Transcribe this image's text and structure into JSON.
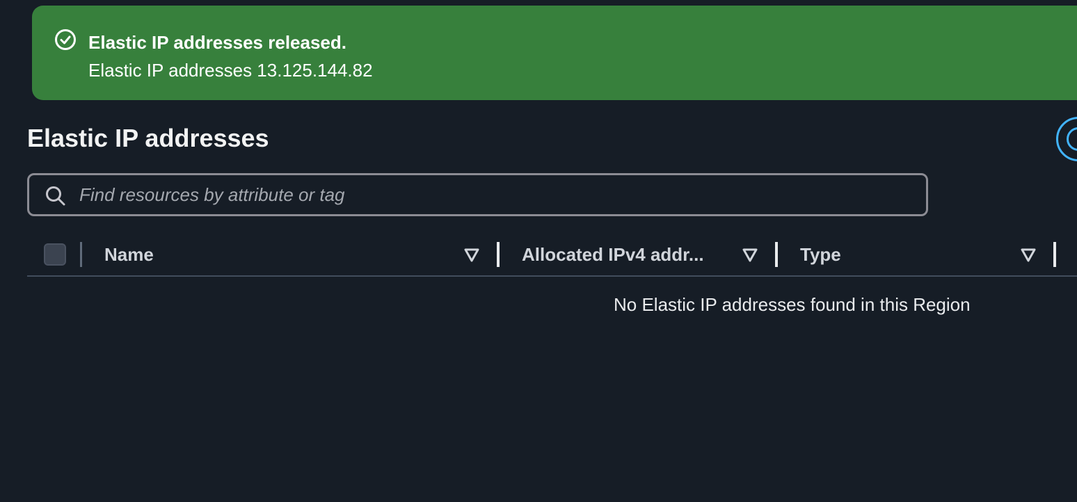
{
  "flash": {
    "type": "success",
    "title": "Elastic IP addresses released.",
    "message": "Elastic IP addresses 13.125.144.82",
    "icon": "check-circle-icon",
    "background_color": "#37803c"
  },
  "page": {
    "title": "Elastic IP addresses"
  },
  "search": {
    "placeholder": "Find resources by attribute or tag",
    "value": ""
  },
  "table": {
    "columns": [
      {
        "label": "Name",
        "sort_icon": "sort-caret-down-icon"
      },
      {
        "label": "Allocated IPv4 addr...",
        "sort_icon": "sort-caret-down-icon"
      },
      {
        "label": "Type",
        "sort_icon": "sort-caret-down-icon"
      }
    ],
    "rows": [],
    "empty_message": "No Elastic IP addresses found in this Region"
  },
  "colors": {
    "background": "#161d26",
    "accent_blue": "#42b4ff",
    "success_green": "#37803c"
  }
}
